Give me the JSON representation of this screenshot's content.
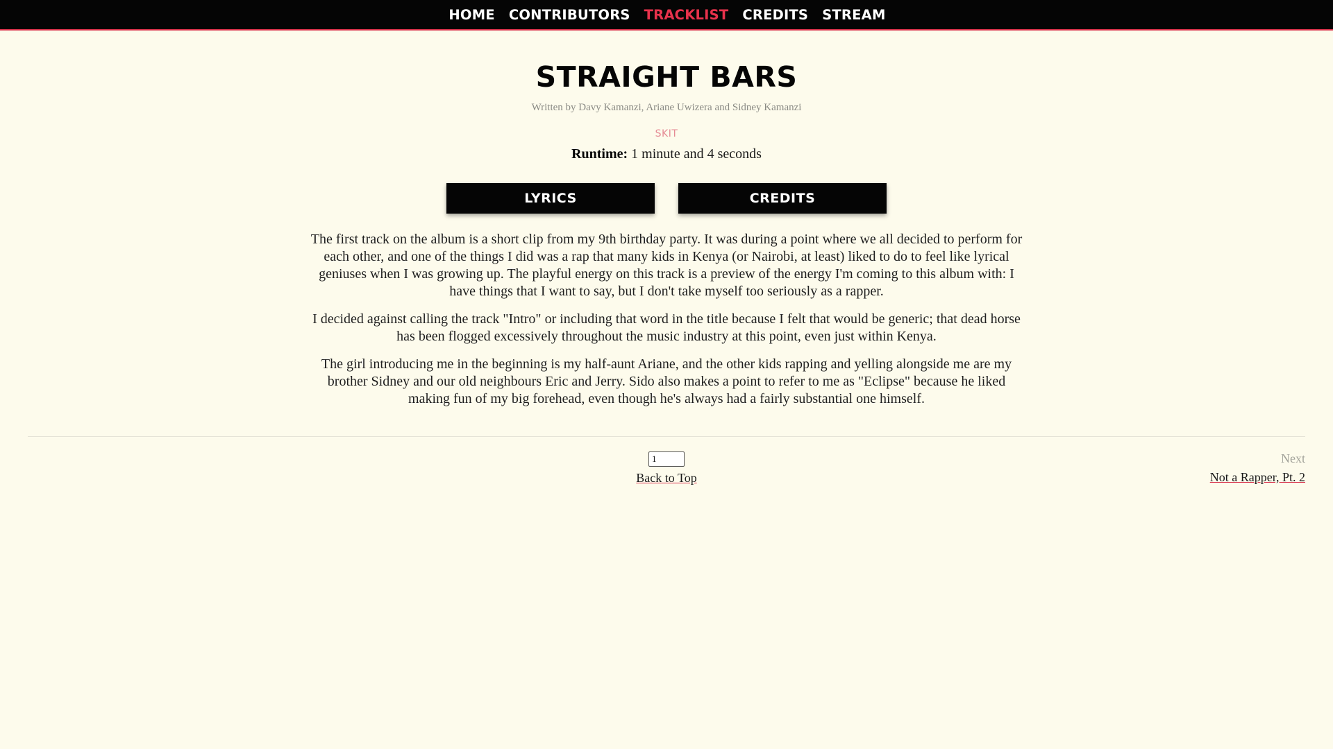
{
  "nav": {
    "items": [
      {
        "label": "HOME",
        "active": false
      },
      {
        "label": "CONTRIBUTORS",
        "active": false
      },
      {
        "label": "TRACKLIST",
        "active": true
      },
      {
        "label": "CREDITS",
        "active": false
      },
      {
        "label": "STREAM",
        "active": false
      }
    ]
  },
  "track": {
    "title": "STRAIGHT BARS",
    "written_by": "Written by Davy Kamanzi, Ariane Uwizera and Sidney Kamanzi",
    "type": "SKIT",
    "runtime_label": "Runtime:",
    "runtime_value": " 1 minute and 4 seconds"
  },
  "tabs": {
    "lyrics_label": "LYRICS",
    "credits_label": "CREDITS"
  },
  "description": {
    "paragraphs": [
      "The first track on the album is a short clip from my 9th birthday party. It was during a point where we all decided to perform for each other, and one of the things I did was a rap that many kids in Kenya (or Nairobi, at least) liked to do to feel like lyrical geniuses when I was growing up. The playful energy on this track is a preview of the energy I'm coming to this album with: I have things that I want to say, but I don't take myself too seriously as a rapper.",
      "I decided against calling the track \"Intro\" or including that word in the title because I felt that would be generic; that dead horse has been flogged excessively throughout the music industry at this point, even just within Kenya.",
      "The girl introducing me in the beginning is my half-aunt Ariane, and the other kids rapping and yelling alongside me are my brother Sidney and our old neighbours Eric and Jerry. Sido also makes a point to refer to me as \"Eclipse\" because he liked making fun of my big forehead, even though he's always had a fairly substantial one himself."
    ]
  },
  "footer": {
    "track_number_value": "1",
    "back_to_top_label": "Back to Top",
    "next_label": "Next",
    "next_track_title": "Not a Rapper, Pt. 2"
  },
  "colors": {
    "accent": "#e8324c",
    "background": "#fdfbec",
    "nav_background": "#050505",
    "type_label": "#e58a94"
  }
}
